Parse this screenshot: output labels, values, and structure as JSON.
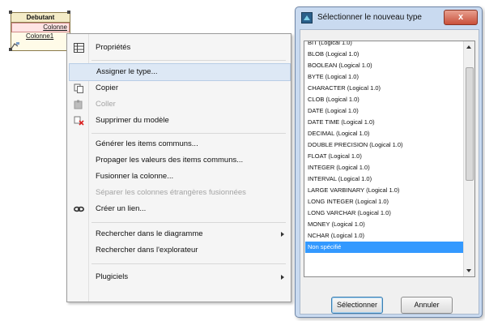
{
  "diagram": {
    "entity_name": "Debutant",
    "rows": [
      "Colonne",
      "Colonne1"
    ]
  },
  "context_menu": {
    "items": [
      {
        "label": "Propriétés",
        "icon": "table-icon",
        "enabled": true
      },
      {
        "label": "Assigner le type...",
        "icon": "",
        "enabled": true,
        "highlighted": true
      },
      {
        "label": "Copier",
        "icon": "copy-icon",
        "enabled": true
      },
      {
        "label": "Coller",
        "icon": "paste-icon",
        "enabled": false
      },
      {
        "label": "Supprimer du modèle",
        "icon": "delete-icon",
        "enabled": true
      },
      {
        "label": "Générer les items communs...",
        "icon": "",
        "enabled": true
      },
      {
        "label": "Propager les valeurs des items communs...",
        "icon": "",
        "enabled": true
      },
      {
        "label": "Fusionner la colonne...",
        "icon": "",
        "enabled": true
      },
      {
        "label": "Séparer les colonnes étrangères fusionnées",
        "icon": "",
        "enabled": false
      },
      {
        "label": "Créer un lien...",
        "icon": "link-icon",
        "enabled": true
      },
      {
        "label": "Rechercher dans le diagramme",
        "icon": "",
        "enabled": true,
        "submenu": true
      },
      {
        "label": "Rechercher dans l'explorateur",
        "icon": "",
        "enabled": true
      },
      {
        "label": "Plugiciels",
        "icon": "",
        "enabled": true,
        "submenu": true
      }
    ]
  },
  "dialog": {
    "title": "Sélectionner le nouveau type",
    "close_label": "x",
    "types": [
      "BIT (Logical 1.0)",
      "BLOB (Logical 1.0)",
      "BOOLEAN (Logical 1.0)",
      "BYTE (Logical 1.0)",
      "CHARACTER (Logical 1.0)",
      "CLOB (Logical 1.0)",
      "DATE (Logical 1.0)",
      "DATE TIME (Logical 1.0)",
      "DECIMAL (Logical 1.0)",
      "DOUBLE PRECISION (Logical 1.0)",
      "FLOAT (Logical 1.0)",
      "INTEGER (Logical 1.0)",
      "INTERVAL (Logical 1.0)",
      "LARGE VARBINARY (Logical 1.0)",
      "LONG INTEGER (Logical 1.0)",
      "LONG VARCHAR (Logical 1.0)",
      "MONEY (Logical 1.0)",
      "NCHAR (Logical 1.0)",
      "Non spécifié"
    ],
    "selected_type": "Non spécifié",
    "select_button": "Sélectionner",
    "cancel_button": "Annuler"
  },
  "colors": {
    "selection": "#3399ff",
    "menu_highlight": "#dde8f5",
    "dialog_frame": "#c9daf0",
    "close_button": "#c9503a"
  }
}
